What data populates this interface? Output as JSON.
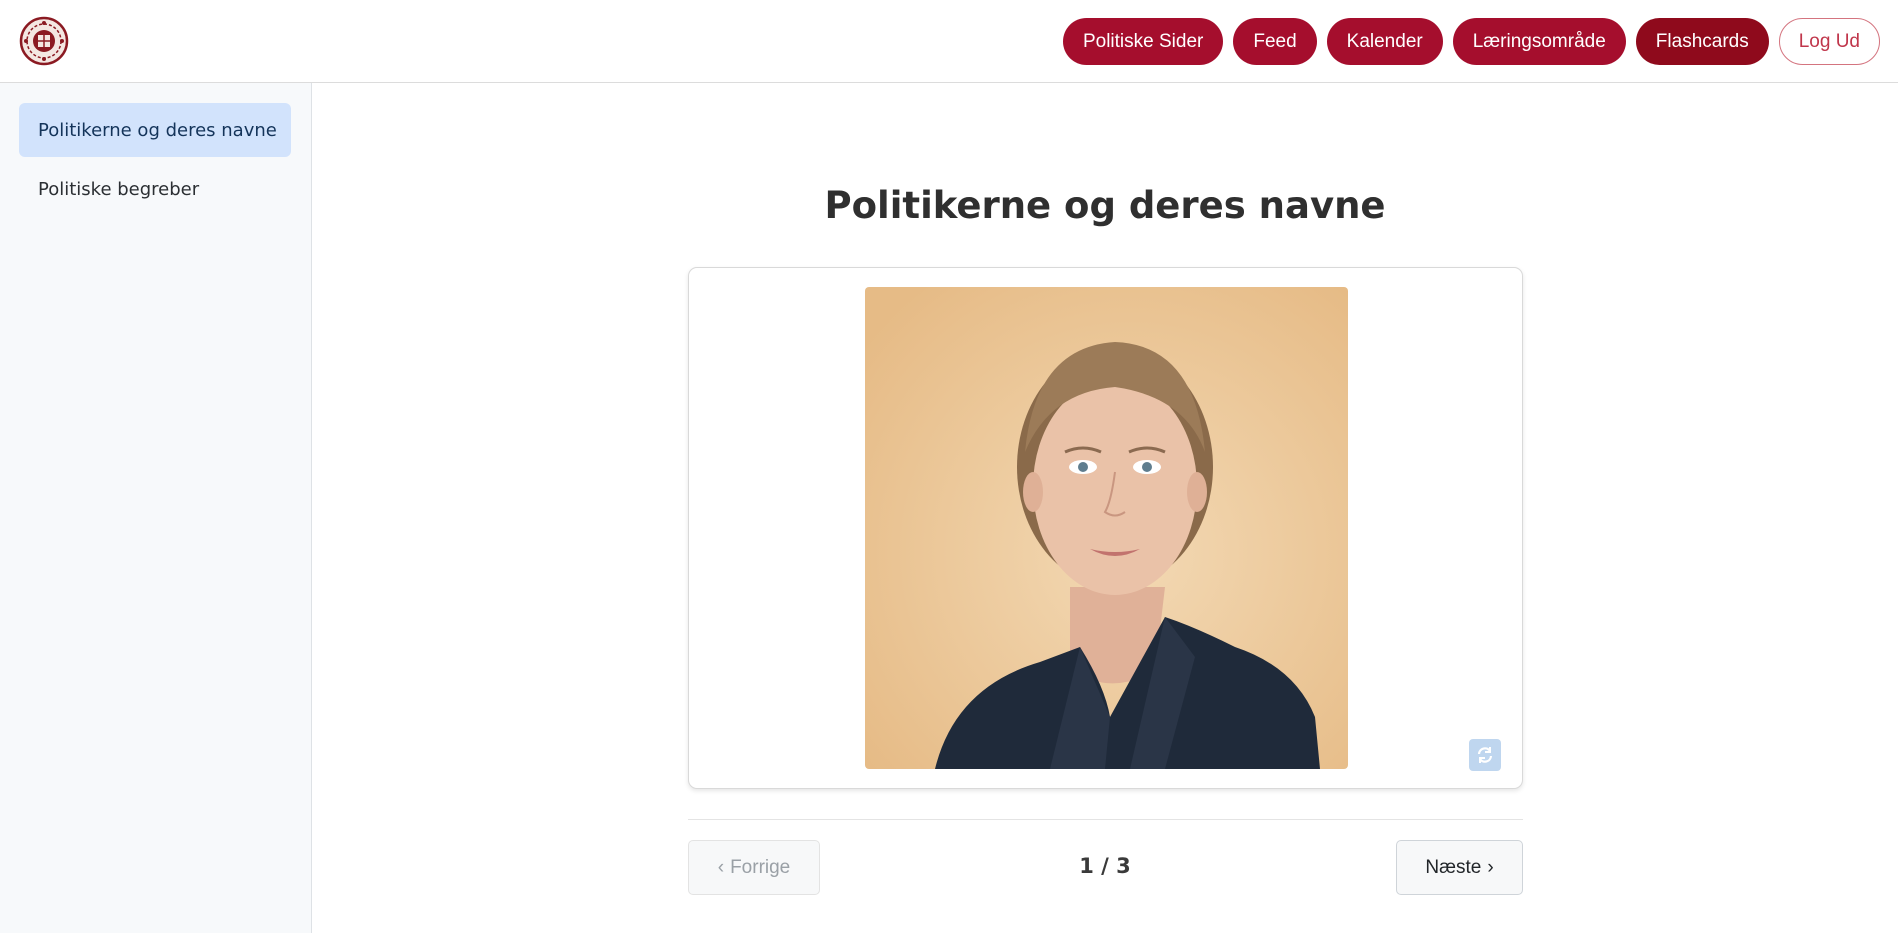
{
  "header": {
    "logo_icon": "royal-crest-logo-icon",
    "nav": [
      {
        "label": "Politiske Sider"
      },
      {
        "label": "Feed"
      },
      {
        "label": "Kalender"
      },
      {
        "label": "Læringsområde"
      },
      {
        "label": "Flashcards"
      }
    ],
    "logout_label": "Log Ud"
  },
  "sidebar": {
    "items": [
      {
        "label": "Politikerne og deres navne",
        "active": true
      },
      {
        "label": "Politiske begreber",
        "active": false
      }
    ]
  },
  "main": {
    "title": "Politikerne og deres navne",
    "flip_icon": "refresh-icon",
    "prev_label": "Forrige",
    "next_label": "Næste",
    "counter": "1 / 3"
  },
  "colors": {
    "brand": "#a50e2d",
    "brand_active": "#8f0a1c",
    "sidebar_active": "#d2e3fc"
  }
}
